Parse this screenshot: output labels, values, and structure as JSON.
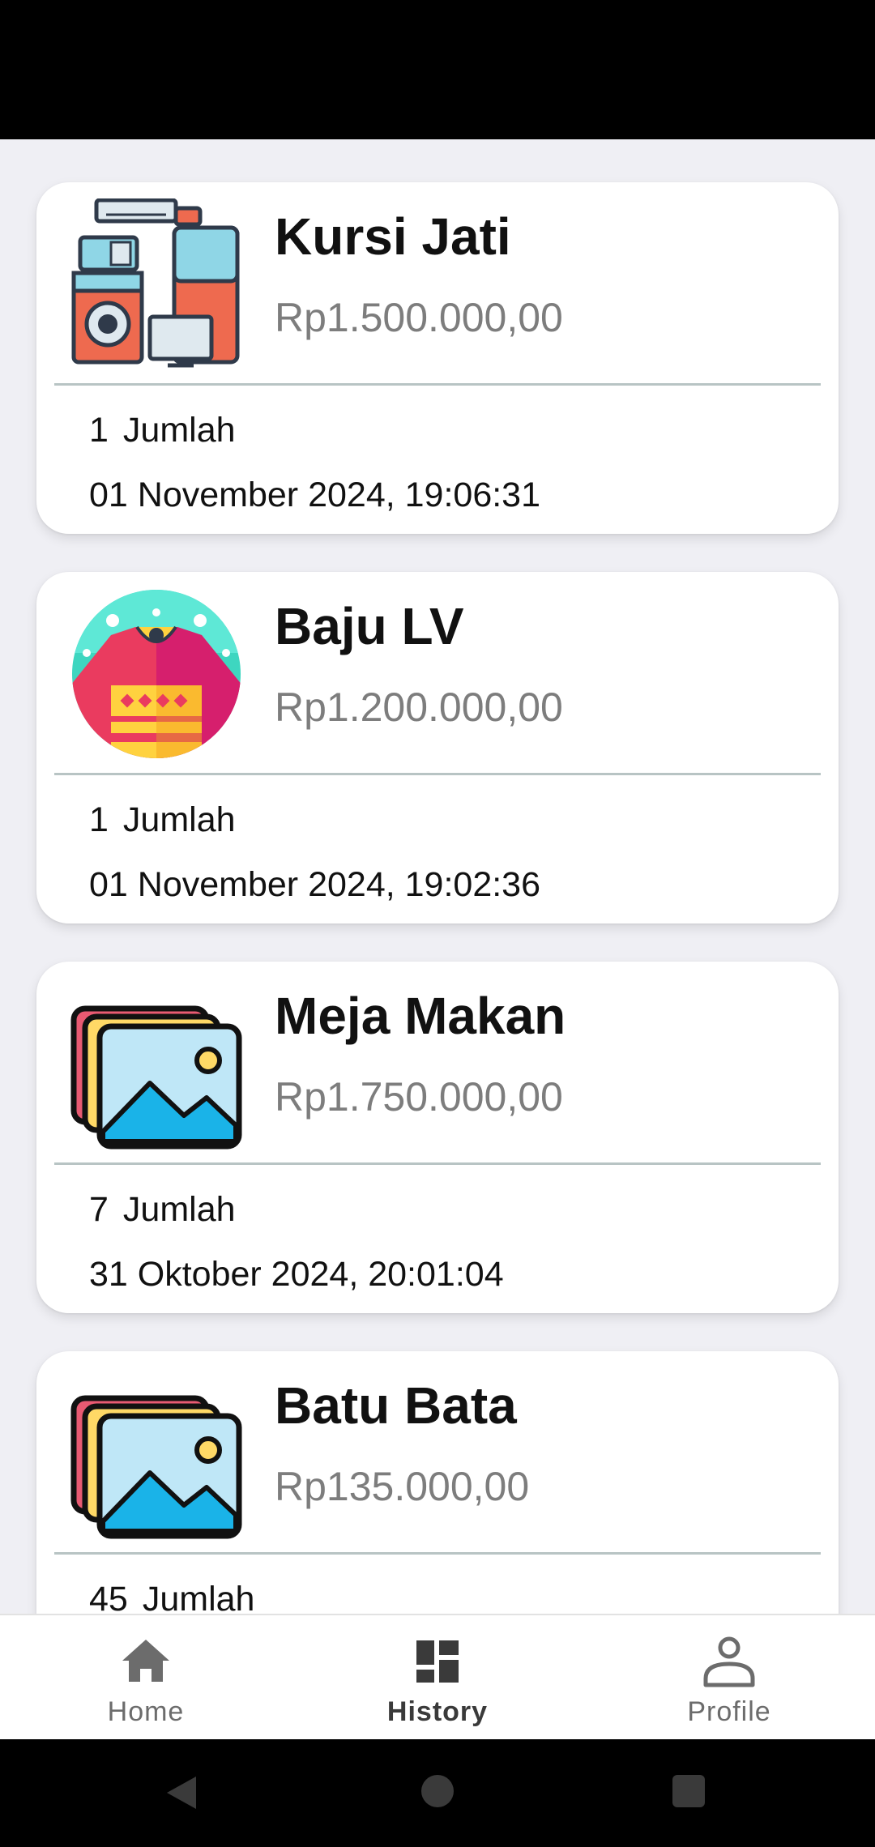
{
  "history": {
    "items": [
      {
        "name": "Kursi Jati",
        "price": "Rp1.500.000,00",
        "quantity": "1",
        "quantity_label": "Jumlah",
        "date": "01 November 2024, 19:06:31",
        "image_icon": "appliances-icon"
      },
      {
        "name": "Baju LV",
        "price": "Rp1.200.000,00",
        "quantity": "1",
        "quantity_label": "Jumlah",
        "date": "01 November 2024, 19:02:36",
        "image_icon": "sweater-icon"
      },
      {
        "name": "Meja Makan",
        "price": "Rp1.750.000,00",
        "quantity": "7",
        "quantity_label": "Jumlah",
        "date": "31 Oktober 2024, 20:01:04",
        "image_icon": "image-placeholder-icon"
      },
      {
        "name": "Batu Bata",
        "price": "Rp135.000,00",
        "quantity": "45",
        "quantity_label": "Jumlah",
        "date": "",
        "image_icon": "image-placeholder-icon"
      }
    ]
  },
  "bottom_nav": {
    "items": [
      {
        "label": "Home",
        "icon": "home-icon",
        "active": false
      },
      {
        "label": "History",
        "icon": "dashboard-icon",
        "active": true
      },
      {
        "label": "Profile",
        "icon": "person-icon",
        "active": false
      }
    ]
  },
  "colors": {
    "background": "#efeff4",
    "card": "#ffffff",
    "price_text": "#7d7d7d",
    "divider": "#b8c4c4",
    "nav_active": "#3a3a3a",
    "nav_inactive": "#6c6c6c"
  }
}
